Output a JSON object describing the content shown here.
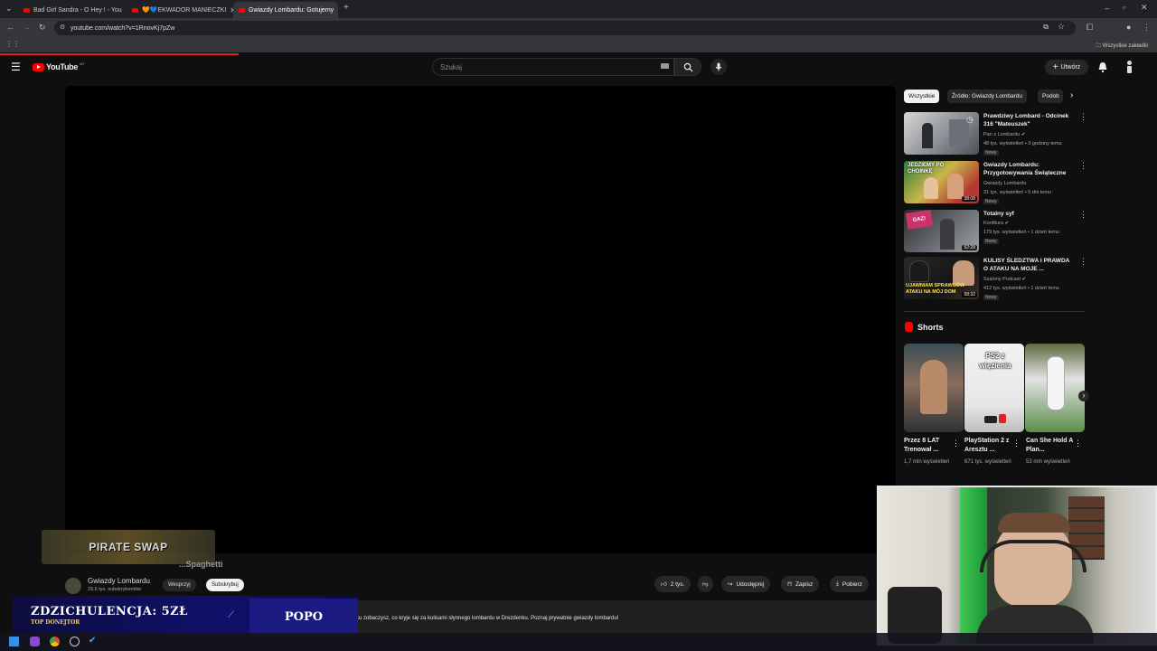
{
  "browser": {
    "tabs": [
      {
        "title": "Bad Girl Sandra - O Hey ! - You"
      },
      {
        "title": "🧡💙EKWADOR MANIECZKI"
      },
      {
        "title": "Gwiazdy Lombardu: Gotujemy",
        "active": true
      }
    ],
    "url": "youtube.com/watch?v=1RnovKj7pZw",
    "bookmarks_label": "Wszystkie zakładki"
  },
  "youtube": {
    "logo": "YouTube",
    "logo_suffix": "MT",
    "search_placeholder": "Szukaj",
    "create_label": "Utwórz"
  },
  "chips": [
    "Wszystkie",
    "Źródło: Gwiazdy Lombardu",
    "Podob"
  ],
  "recommendations": [
    {
      "title": "Prawdziwy Lombard - Odcinek 316 \"Mateuszek\"",
      "channel": "Pan z Lombardu",
      "meta": "48 tys. wyświetleń • 3 godziny temu",
      "badge": "Nowy",
      "duration": ""
    },
    {
      "title": "Gwiazdy Lombardu: Przygotowywania Świąteczne",
      "channel": "Gwiazdy Lombardu",
      "meta": "31 tys. wyświetleń • 5 dni temu",
      "badge": "Nowy",
      "duration": "38:08"
    },
    {
      "title": "Totalny syf",
      "channel": "Konfitura",
      "meta": "179 tys. wyświetleń • 1 dzień temu",
      "badge": "Nowy",
      "duration": "52:28"
    },
    {
      "title": "KULISY ŚLEDZTWA I PRAWDA O ATAKU NA MOJE ...",
      "channel": "Szalony Podcast",
      "meta": "412 tys. wyświetleń • 1 dzień temu",
      "badge": "Nowy",
      "duration": "58:32"
    }
  ],
  "thumb_texts": {
    "t2": "JEDZIEMY PO CHOINKĘ",
    "t3": "GAZ!",
    "t4": "UJAWNIAM SPRAWCÓW ATAKU NA MÓJ DOM"
  },
  "shorts": {
    "heading": "Shorts",
    "items": [
      {
        "title": "Przez 8 LAT Trenował ...",
        "views": "1,7 mln wyświetleń"
      },
      {
        "title": "PlayStation 2 z Aresztu ...",
        "views": "671 tys. wyświetleń",
        "overlay": "PS2 z więzienia"
      },
      {
        "title": "Can She Hold A Plan...",
        "views": "53 mln wyświetleń"
      }
    ]
  },
  "video": {
    "title_partial": "...Spaghetti",
    "channel": "Gwiazdy Lombardu",
    "subs": "29,6 tys. subskrybentów",
    "support_label": "Wesprzyj",
    "subscribe_label": "Subskrybuj",
    "likes": "2 tys.",
    "share_label": "Udostępnij",
    "save_label": "Zapisz",
    "download_label": "Pobierz",
    "description": "ku zobaczysz, co kryje się za kulisami słynnego lombardu w Drezdenku. Poznaj prywatnie gwiazdy lombardu!"
  },
  "overlays": {
    "pirate_logo": "PIRATE SWAP",
    "donation_title": "ZDZICHULENCJA: 5ZŁ",
    "donation_sub": "TOP DONEJTOR",
    "donation_name": "POPO"
  }
}
